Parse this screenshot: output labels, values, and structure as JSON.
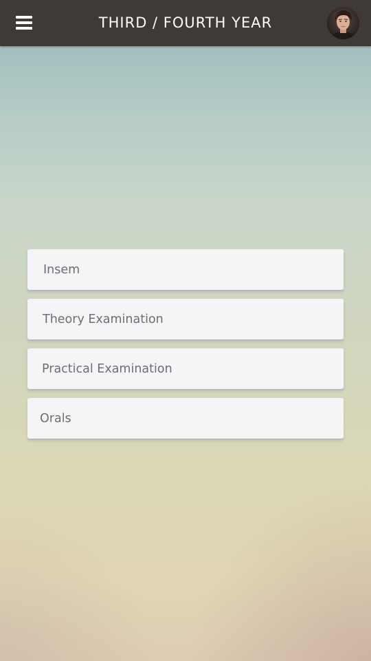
{
  "header": {
    "title": "THIRD / FOURTH YEAR",
    "menu_icon": "hamburger-menu-icon",
    "avatar": "user-profile-photo"
  },
  "menu": {
    "items": [
      {
        "label": "Insem"
      },
      {
        "label": "Theory Examination"
      },
      {
        "label": "Practical Examination"
      },
      {
        "label": "Orals"
      }
    ]
  },
  "colors": {
    "header_bg": "#3f3a36",
    "card_bg": "#f5f5f7",
    "card_text": "#6e6e72",
    "title_text": "#ffffff"
  }
}
